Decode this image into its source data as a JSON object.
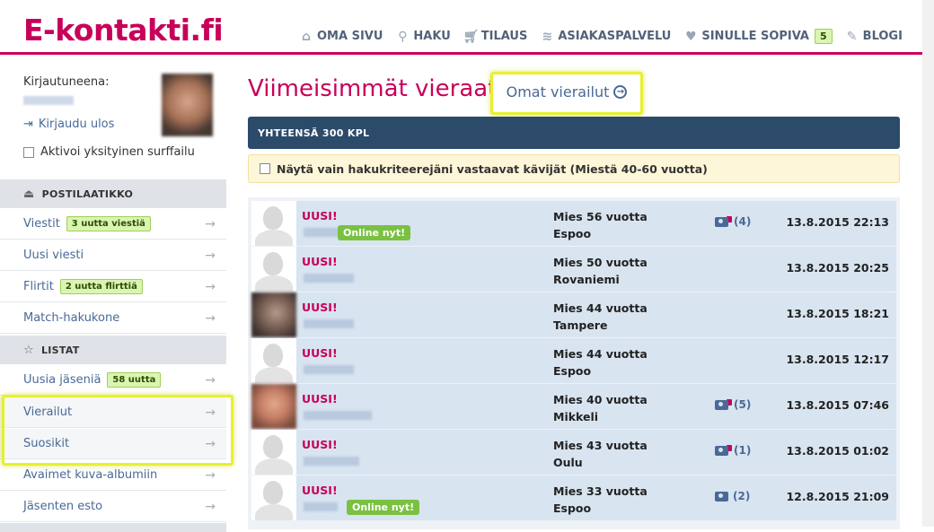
{
  "header": {
    "logo": "E-kontakti.fi",
    "nav": [
      {
        "label": "OMA SIVU",
        "icon": "home-icon"
      },
      {
        "label": "HAKU",
        "icon": "search-icon"
      },
      {
        "label": "TILAUS",
        "icon": "cart-icon"
      },
      {
        "label": "ASIAKASPALVELU",
        "icon": "layers-icon"
      },
      {
        "label": "SINULLE SOPIVA",
        "icon": "heart-icon",
        "badge": "5"
      },
      {
        "label": "BLOGI",
        "icon": "pencil-icon"
      }
    ]
  },
  "sidebar": {
    "logged_in_label": "Kirjautuneena:",
    "logout_label": "Kirjaudu ulos",
    "private_surf_label": "Aktivoi yksityinen surffailu",
    "sections": [
      {
        "title": "POSTILAATIKKO",
        "icon": "inbox-icon"
      },
      {
        "title": "LISTAT",
        "icon": "star-icon"
      }
    ],
    "mailbox_items": [
      {
        "label": "Viestit",
        "badge": "3 uutta viestiä"
      },
      {
        "label": "Uusi viesti",
        "badge": ""
      },
      {
        "label": "Flirtit",
        "badge": "2 uutta flirttiä"
      },
      {
        "label": "Match-hakukone",
        "badge": ""
      }
    ],
    "list_items": [
      {
        "label": "Uusia jäseniä",
        "badge": "58 uutta"
      },
      {
        "label": "Vierailut",
        "badge": ""
      },
      {
        "label": "Suosikit",
        "badge": ""
      },
      {
        "label": "Avaimet kuva-albumiin",
        "badge": ""
      },
      {
        "label": "Jäsenten esto",
        "badge": ""
      }
    ]
  },
  "main": {
    "title": "Viimeisimmät vieraat",
    "own_visits_label": "Omat vierailut",
    "total_label": "YHTEENSÄ 300 KPL",
    "filter_label": "Näytä vain hakukriteerejäni vastaavat kävijät (Miestä 40-60 vuotta)",
    "new_label": "UUSI!",
    "online_label": "Online nyt!",
    "visitors": [
      {
        "info1": "Mies 56 vuotta",
        "info2": "Espoo",
        "photos": "(4)",
        "locked": true,
        "date": "13.8.2015 22:13",
        "online": true,
        "thumb": "silhouette"
      },
      {
        "info1": "Mies 50 vuotta",
        "info2": "Rovaniemi",
        "photos": "",
        "locked": false,
        "date": "13.8.2015 20:25",
        "online": false,
        "thumb": "silhouette"
      },
      {
        "info1": "Mies 44 vuotta",
        "info2": "Tampere",
        "photos": "",
        "locked": false,
        "date": "13.8.2015 18:21",
        "online": false,
        "thumb": "photo1"
      },
      {
        "info1": "Mies 44 vuotta",
        "info2": "Espoo",
        "photos": "",
        "locked": false,
        "date": "13.8.2015 12:17",
        "online": false,
        "thumb": "silhouette"
      },
      {
        "info1": "Mies 40 vuotta",
        "info2": "Mikkeli",
        "photos": "(5)",
        "locked": true,
        "date": "13.8.2015 07:46",
        "online": false,
        "thumb": "photo2"
      },
      {
        "info1": "Mies 43 vuotta",
        "info2": "Oulu",
        "photos": "(1)",
        "locked": true,
        "date": "13.8.2015 01:02",
        "online": false,
        "thumb": "silhouette"
      },
      {
        "info1": "Mies 33 vuotta",
        "info2": "Espoo",
        "photos": "(2)",
        "locked": false,
        "date": "12.8.2015 21:09",
        "online": true,
        "thumb": "silhouette"
      }
    ]
  },
  "colors": {
    "brand": "#c8005a",
    "nav_text": "#52627a",
    "link": "#4a6996",
    "highlight": "#e7f02d",
    "total_bar": "#2c4a6a",
    "row_bg": "#d8e4f0"
  }
}
